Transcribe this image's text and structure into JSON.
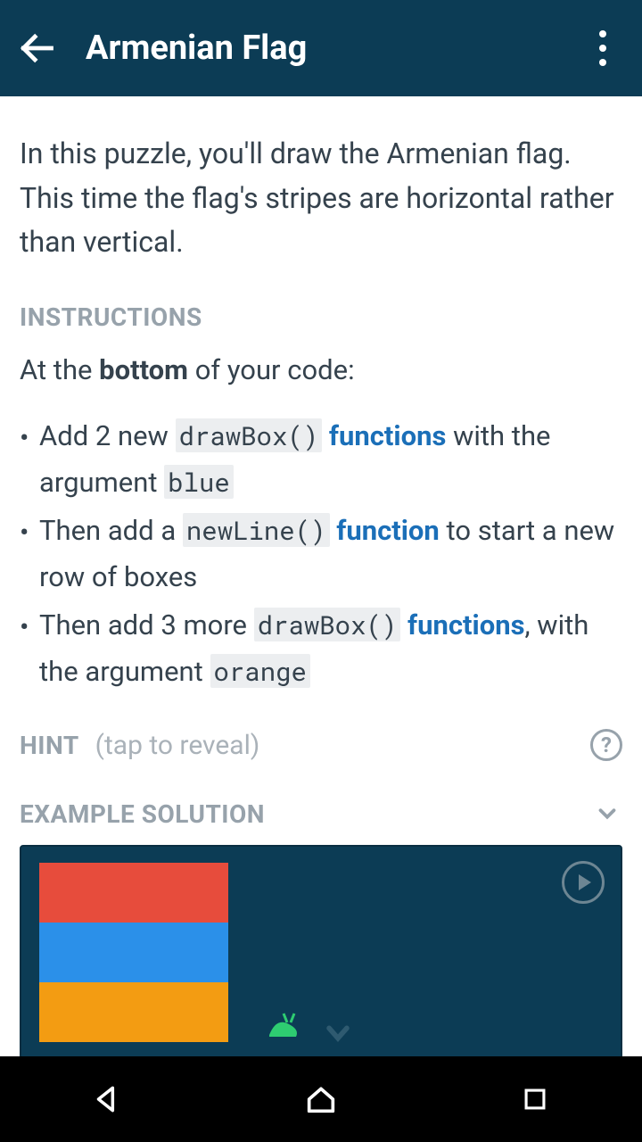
{
  "appbar": {
    "title": "Armenian Flag"
  },
  "intro": "In this puzzle, you'll draw the Armenian flag. This time the flag's stripes are horizontal rather than vertical.",
  "sections": {
    "instructions_label": "INSTRUCTIONS",
    "instructions_lead_pre": "At the ",
    "instructions_lead_bold": "bottom",
    "instructions_lead_post": " of your code:",
    "hint_label": "HINT",
    "hint_sub": "(tap to reveal)",
    "example_label": "EXAMPLE SOLUTION"
  },
  "bullets": [
    {
      "parts": [
        {
          "t": "Add 2 new ",
          "cls": ""
        },
        {
          "t": "drawBox()",
          "cls": "code"
        },
        {
          "t": " ",
          "cls": ""
        },
        {
          "t": "functions",
          "cls": "kw"
        },
        {
          "t": " with the argument ",
          "cls": ""
        },
        {
          "t": "blue",
          "cls": "code"
        }
      ]
    },
    {
      "parts": [
        {
          "t": "Then add a ",
          "cls": ""
        },
        {
          "t": "newLine()",
          "cls": "code"
        },
        {
          "t": " ",
          "cls": ""
        },
        {
          "t": "function",
          "cls": "kw"
        },
        {
          "t": " to start a new row of boxes",
          "cls": ""
        }
      ]
    },
    {
      "parts": [
        {
          "t": "Then add 3 more ",
          "cls": ""
        },
        {
          "t": "drawBox()",
          "cls": "code"
        },
        {
          "t": " ",
          "cls": ""
        },
        {
          "t": "functions",
          "cls": "kw"
        },
        {
          "t": ", with the argument ",
          "cls": ""
        },
        {
          "t": "orange",
          "cls": "code"
        }
      ]
    }
  ],
  "flag_colors": [
    "red",
    "blue",
    "orange"
  ],
  "help_glyph": "?"
}
